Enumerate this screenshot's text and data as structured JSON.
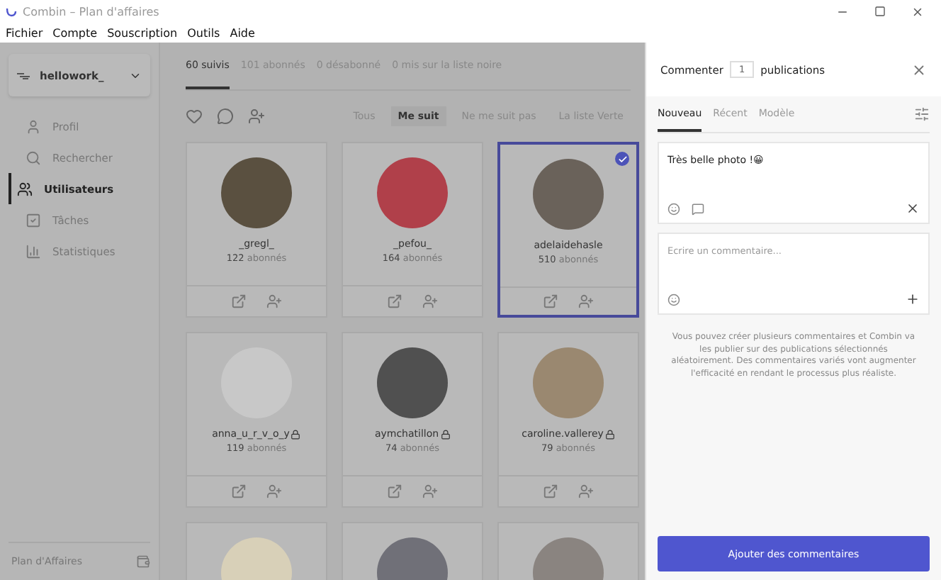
{
  "window": {
    "title": "Combin – Plan d'affaires"
  },
  "menu": [
    "Fichier",
    "Compte",
    "Souscription",
    "Outils",
    "Aide"
  ],
  "account": {
    "name": "hellowork_"
  },
  "sidebar": {
    "items": [
      {
        "label": "Profil",
        "selected": false
      },
      {
        "label": "Rechercher",
        "selected": false
      },
      {
        "label": "Utilisateurs",
        "selected": true
      },
      {
        "label": "Tâches",
        "selected": false
      },
      {
        "label": "Statistiques",
        "selected": false
      }
    ],
    "plan": "Plan d'Affaires"
  },
  "tabs": [
    {
      "label": "60 suivis",
      "selected": true
    },
    {
      "label": "101 abonnés",
      "selected": false
    },
    {
      "label": "0 désabonné",
      "selected": false
    },
    {
      "label": "0 mis sur la liste noire",
      "selected": false
    }
  ],
  "filters": [
    {
      "label": "Tous",
      "selected": false
    },
    {
      "label": "Me suit",
      "selected": true
    },
    {
      "label": "Ne me suit pas",
      "selected": false
    },
    {
      "label": "La liste Verte",
      "selected": false
    }
  ],
  "users": [
    {
      "name": "_gregl_",
      "count": "122",
      "unit": "abonnés",
      "locked": false,
      "selected": false,
      "color": "#5a5040"
    },
    {
      "name": "_pefou_",
      "count": "164",
      "unit": "abonnés",
      "locked": false,
      "selected": false,
      "color": "#b0404a"
    },
    {
      "name": "adelaidehasle",
      "count": "510",
      "unit": "abonnés",
      "locked": false,
      "selected": true,
      "color": "#6a625a"
    },
    {
      "name": "anna_u_r_v_o_y",
      "count": "119",
      "unit": "abonnés",
      "locked": true,
      "selected": false,
      "color": "#c8c8c8"
    },
    {
      "name": "aymchatillon",
      "count": "74",
      "unit": "abonnés",
      "locked": true,
      "selected": false,
      "color": "#505050"
    },
    {
      "name": "caroline.vallerey",
      "count": "79",
      "unit": "abonnés",
      "locked": true,
      "selected": false,
      "color": "#9a8870"
    },
    {
      "selected": false,
      "color": "#d8d0b8"
    },
    {
      "selected": false,
      "color": "#707078"
    },
    {
      "selected": false,
      "color": "#8a8480"
    }
  ],
  "panel": {
    "title_before": "Commenter",
    "count": "1",
    "title_after": "publications",
    "tabs": [
      {
        "label": "Nouveau",
        "selected": true
      },
      {
        "label": "Récent",
        "selected": false
      },
      {
        "label": "Modèle",
        "selected": false
      }
    ],
    "comment": "Très belle photo !😀",
    "placeholder": "Ecrire un commentaire...",
    "note": "Vous pouvez créer plusieurs commentaires et Combin va les publier sur des publications sélectionnés aléatoirement. Des commentaires variés vont augmenter l'efficacité en rendant le processus plus réaliste.",
    "button": "Ajouter des commentaires"
  }
}
